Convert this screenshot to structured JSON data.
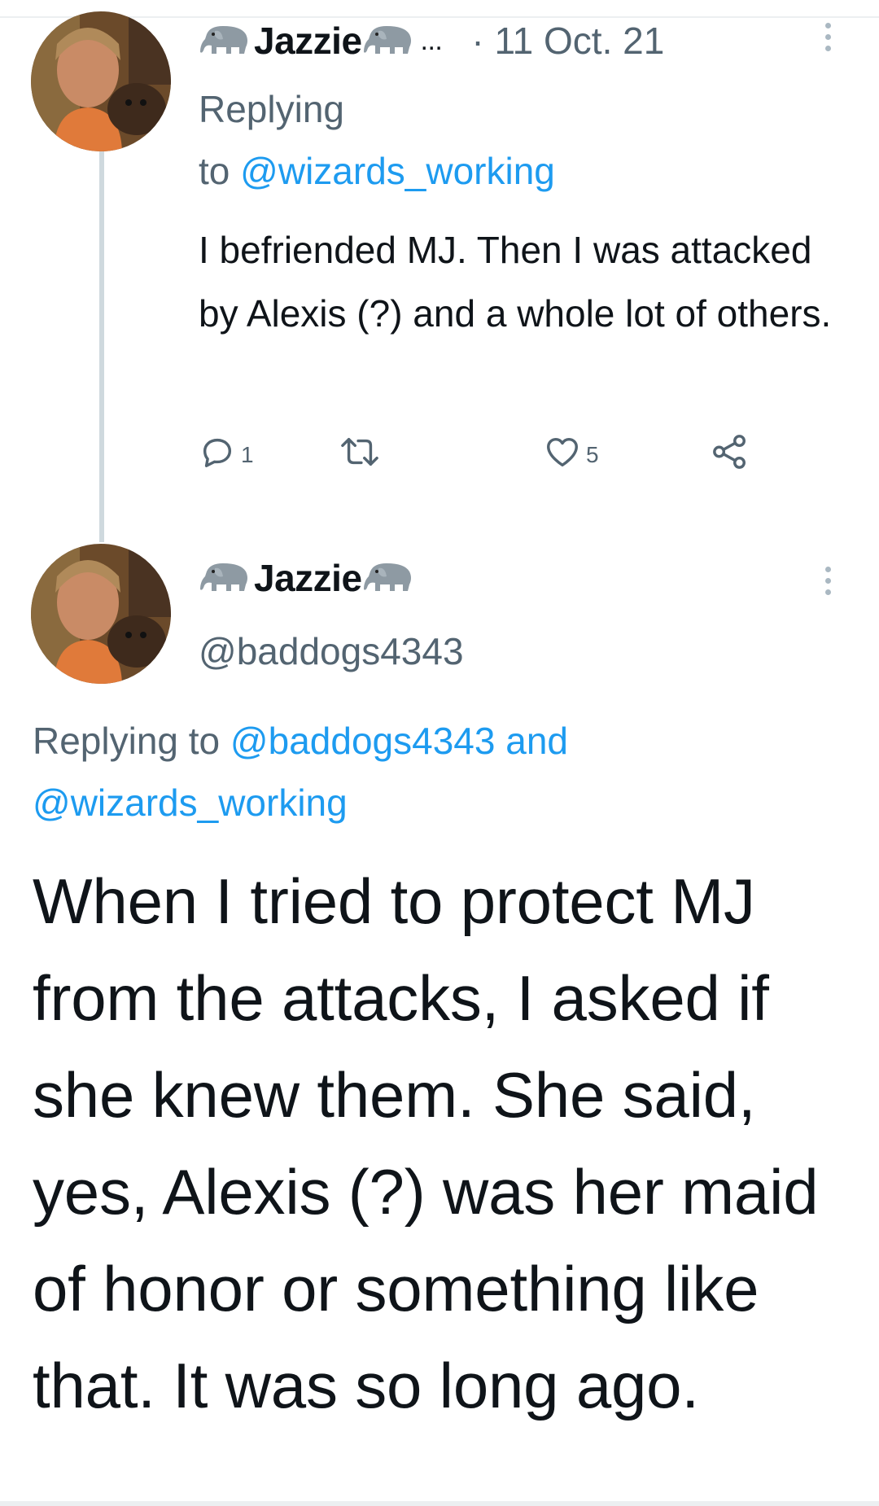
{
  "tweet1": {
    "display_name": "Jazzie",
    "name_emoji": "elephant-icon",
    "ellipsis": "...",
    "date": "· 11 Oct. 21",
    "replying_label": "Replying",
    "replying_to_prefix": "to",
    "replying_to_handle": "@wizards_working",
    "text": "I befriended MJ. Then I was attacked by Alexis (?) and a whole lot of others.",
    "reply_count": "1",
    "like_count": "5"
  },
  "tweet2": {
    "display_name": "Jazzie",
    "name_emoji": "elephant-icon",
    "handle": "@baddogs4343",
    "replying_prefix": "Replying to",
    "replying_handle_1": "@baddogs4343",
    "replying_and": "and",
    "replying_handle_2": "@wizards_working",
    "text": "When I tried to protect MJ from the attacks, I asked if she knew them. She said, yes, Alexis (?) was her maid of honor or something like that. It was so long ago."
  },
  "colors": {
    "text": "#0f1419",
    "muted": "#536471",
    "link": "#1d9bf0",
    "thread_line": "#cfd9de"
  }
}
